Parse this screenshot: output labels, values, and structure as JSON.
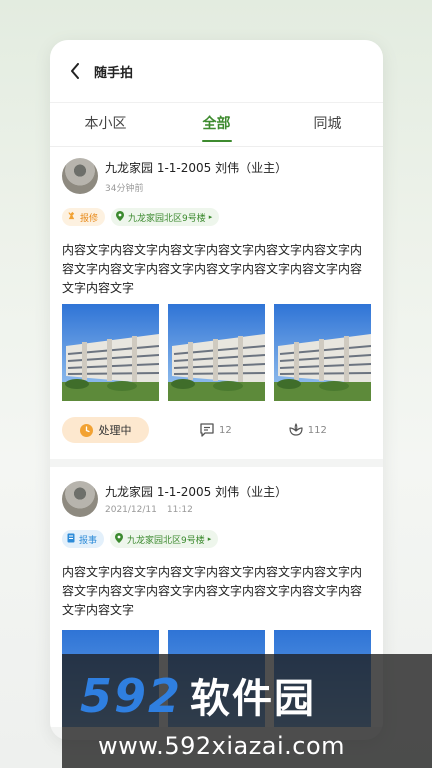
{
  "nav": {
    "title": "随手拍"
  },
  "tabs": [
    {
      "label": "本小区"
    },
    {
      "label": "全部"
    },
    {
      "label": "同城"
    }
  ],
  "posts": [
    {
      "user": "九龙家园 1-1-2005 刘伟（业主）",
      "time": "34分钟前",
      "type_tag": "报修",
      "location_tag": "九龙家园北区9号楼",
      "content": "内容文字内容文字内容文字内容文字内容文字内容文字内容文字内容文字内容文字内容文字内容文字内容文字内容文字内容文字",
      "status": "处理中",
      "comments": "12",
      "likes": "112"
    },
    {
      "user": "九龙家园 1-1-2005 刘伟（业主）",
      "date": "2021/12/11",
      "time": "11:12",
      "type_tag": "报事",
      "location_tag": "九龙家园北区9号楼",
      "content": "内容文字内容文字内容文字内容文字内容文字内容文字内容文字内容文字内容文字内容文字内容文字内容文字内容文字内容文字"
    }
  ],
  "watermark": {
    "brand_num": "592",
    "brand_cn": "软件园",
    "url": "www.592xiazai.com"
  },
  "colors": {
    "accent": "#3e8b2f",
    "status_bg": "#fde8cf",
    "repair_tag": "#e88a1a",
    "report_tag": "#2d8bd8"
  }
}
